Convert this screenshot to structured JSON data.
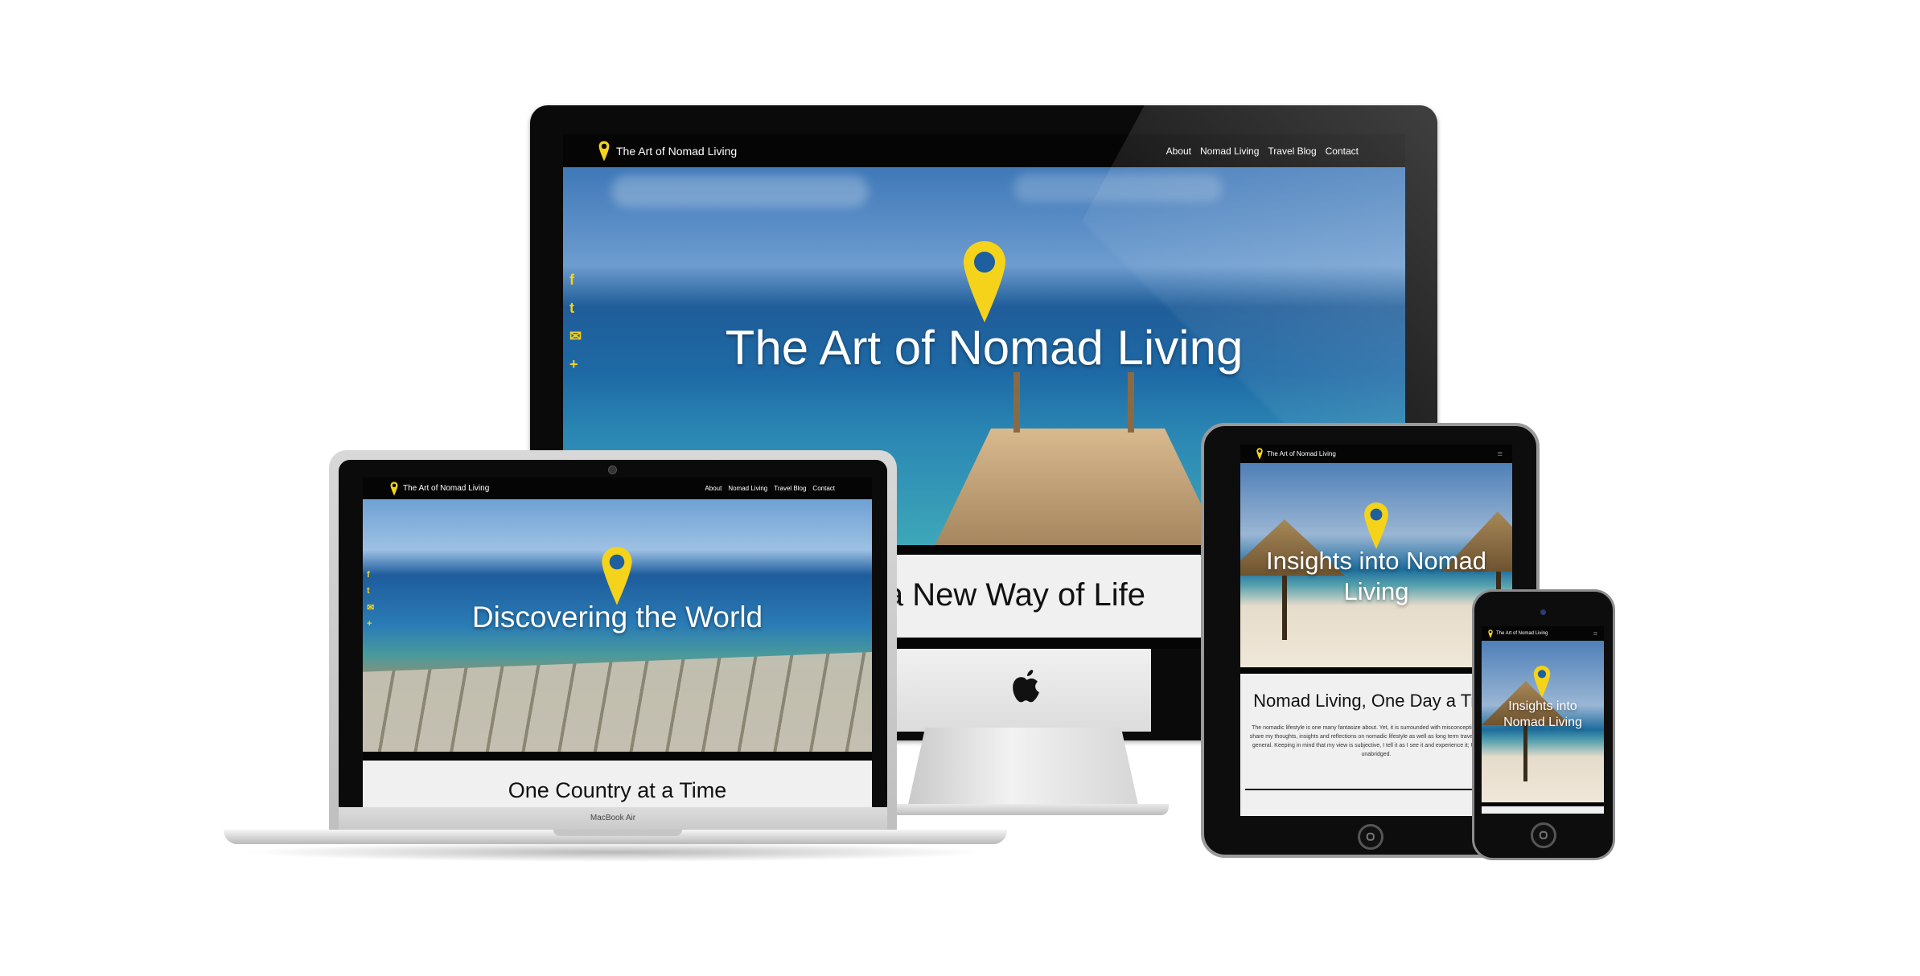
{
  "desktop": {
    "brand": "The Art of Nomad Living",
    "nav": [
      "About",
      "Nomad Living",
      "Travel Blog",
      "Contact"
    ],
    "hero_title": "The Art of Nomad Living",
    "section_title": "Into a New Way of Life"
  },
  "laptop": {
    "brand": "The Art of Nomad Living",
    "nav": [
      "About",
      "Nomad Living",
      "Travel Blog",
      "Contact"
    ],
    "hero_title": "Discovering the World",
    "section_title": "One Country at a Time",
    "device_label": "MacBook Air"
  },
  "tablet": {
    "brand": "The Art of Nomad Living",
    "hero_title": "Insights into Nomad Living",
    "section_title": "Nomad Living, One Day a Time",
    "body_text": "The nomadic lifestyle is one many fantasize about. Yet, it is surrounded with misconceptions. Here, I share my thoughts, insights and reflections on nomadic lifestyle as well as long term travels and life in general. Keeping in mind that my view is subjective, I tell it as I see it and experience it; Upfront and unabridged."
  },
  "phone": {
    "brand": "The Art of Nomad Living",
    "hero_title": "Insights into Nomad Living"
  },
  "icons": {
    "pin": "map-pin-icon",
    "social": [
      "facebook-icon",
      "twitter-icon",
      "email-icon",
      "plus-icon"
    ],
    "menu": "hamburger-icon",
    "logo": "apple-logo-icon"
  },
  "social_glyphs": [
    "f",
    "t",
    "✉",
    "+"
  ],
  "colors": {
    "accent": "#f5d31a",
    "nav_bg": "#050505",
    "section_bg": "#f0f0f0"
  }
}
